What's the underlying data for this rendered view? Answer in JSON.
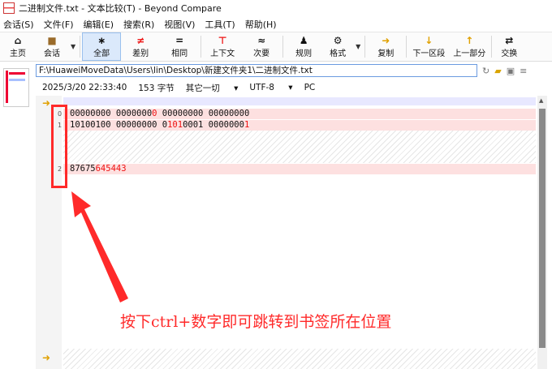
{
  "window": {
    "title": "二进制文件.txt - 文本比较(T) - Beyond Compare"
  },
  "menu": [
    "会话(S)",
    "文件(F)",
    "编辑(E)",
    "搜索(R)",
    "视图(V)",
    "工具(T)",
    "帮助(H)"
  ],
  "toolbar": {
    "home": "主页",
    "session": "会话",
    "all": "全部",
    "diff": "差别",
    "same": "相同",
    "context": "上下文",
    "minor": "次要",
    "rules": "规则",
    "format": "格式",
    "copy": "复制",
    "next_section": "下一区段",
    "prev_section": "上一部分",
    "swap": "交换"
  },
  "file": {
    "path": "F:\\HuaweiMoveData\\Users\\lin\\Desktop\\新建文件夹1\\二进制文件.txt",
    "date": "2025/3/20 22:33:40",
    "size": "153 字节",
    "other": "其它一切",
    "encoding": "UTF-8",
    "line_ending": "PC"
  },
  "lines": [
    {
      "a": "00000000 0000000",
      "b": "0",
      "c": " 00000000 00000000"
    },
    {
      "a": "10100100 00000000 0",
      "b": "101",
      "c": "0001 0000000",
      "d": "1"
    },
    {
      "a": "87675",
      "b": "645443"
    }
  ],
  "bookmarks": [
    "0",
    "1",
    "2"
  ],
  "annotation": "按下ctrl+数字即可跳转到书签所在位置",
  "colors": {
    "accent": "#ff2a2a",
    "diff_line": "#fde0e0"
  }
}
